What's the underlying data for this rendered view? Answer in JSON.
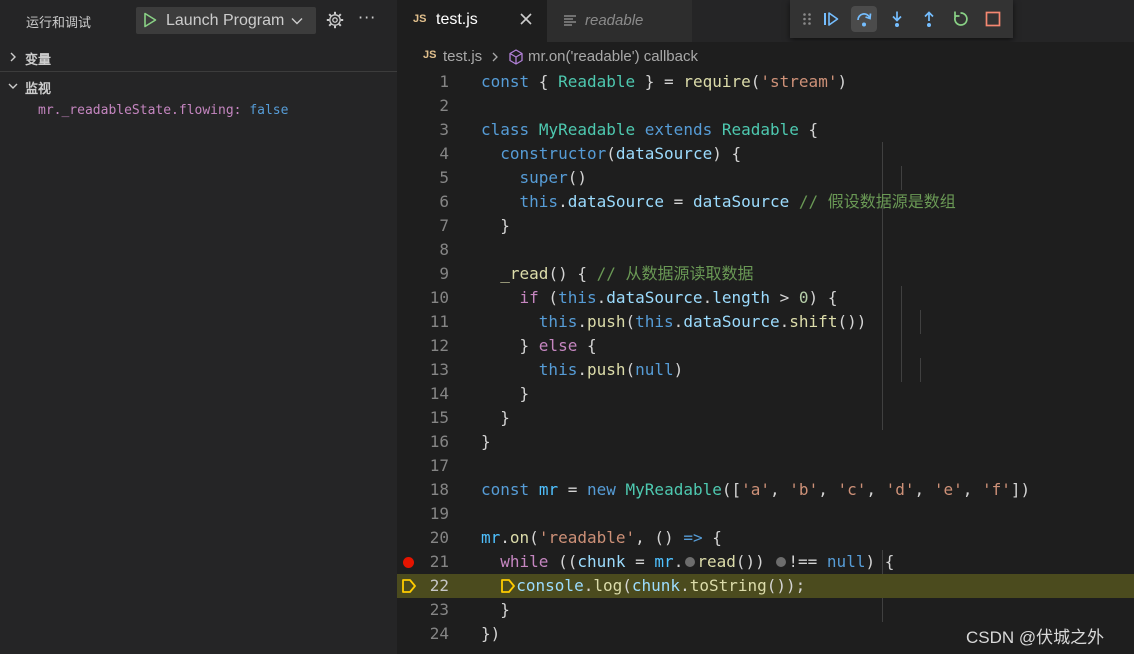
{
  "sidebar": {
    "title": "运行和调试",
    "launch_config": "Launch Program",
    "more": "···",
    "sections": {
      "variables": "变量",
      "watch": "监视"
    },
    "watch_items": [
      {
        "name": "mr._readableState.flowing:",
        "value": "false"
      }
    ]
  },
  "tabs": [
    {
      "badge": "JS",
      "label": "test.js",
      "active": true
    },
    {
      "label": "readable",
      "active": false
    }
  ],
  "breadcrumb": {
    "badge": "JS",
    "file": "test.js",
    "symbol": "mr.on('readable') callback"
  },
  "debug_toolbar": {
    "buttons": [
      "grip-icon",
      "continue-icon",
      "step-over-icon",
      "step-into-icon",
      "step-out-icon",
      "restart-icon",
      "stop-icon"
    ]
  },
  "editor": {
    "current_line": 22,
    "breakpoint_line": 21,
    "line_numbers": [
      "1",
      "2",
      "3",
      "4",
      "5",
      "6",
      "7",
      "8",
      "9",
      "10",
      "11",
      "12",
      "13",
      "14",
      "15",
      "16",
      "17",
      "18",
      "19",
      "20",
      "21",
      "22",
      "23",
      "24"
    ],
    "lines": [
      "const { Readable } = require('stream')",
      "",
      "class MyReadable extends Readable {",
      "  constructor(dataSource) {",
      "    super()",
      "    this.dataSource = dataSource // 假设数据源是数组",
      "  }",
      "",
      "  _read() { // 从数据源读取数据",
      "    if (this.dataSource.length > 0) {",
      "      this.push(this.dataSource.shift())",
      "    } else {",
      "      this.push(null)",
      "    }",
      "  }",
      "}",
      "",
      "const mr = new MyReadable(['a', 'b', 'c', 'd', 'e', 'f'])",
      "",
      "mr.on('readable', () => {",
      "  while ((chunk = mr.read()) !== null) {",
      "    console.log(chunk.toString());",
      "  }",
      "})"
    ]
  },
  "colors": {
    "background": "#1e1e1e",
    "sidebar": "#252526",
    "current_line_highlight": "#4b4b1e",
    "breakpoint": "#e51400",
    "debug_arrow": "#ffcc00"
  },
  "watermark": "CSDN @伏城之外"
}
